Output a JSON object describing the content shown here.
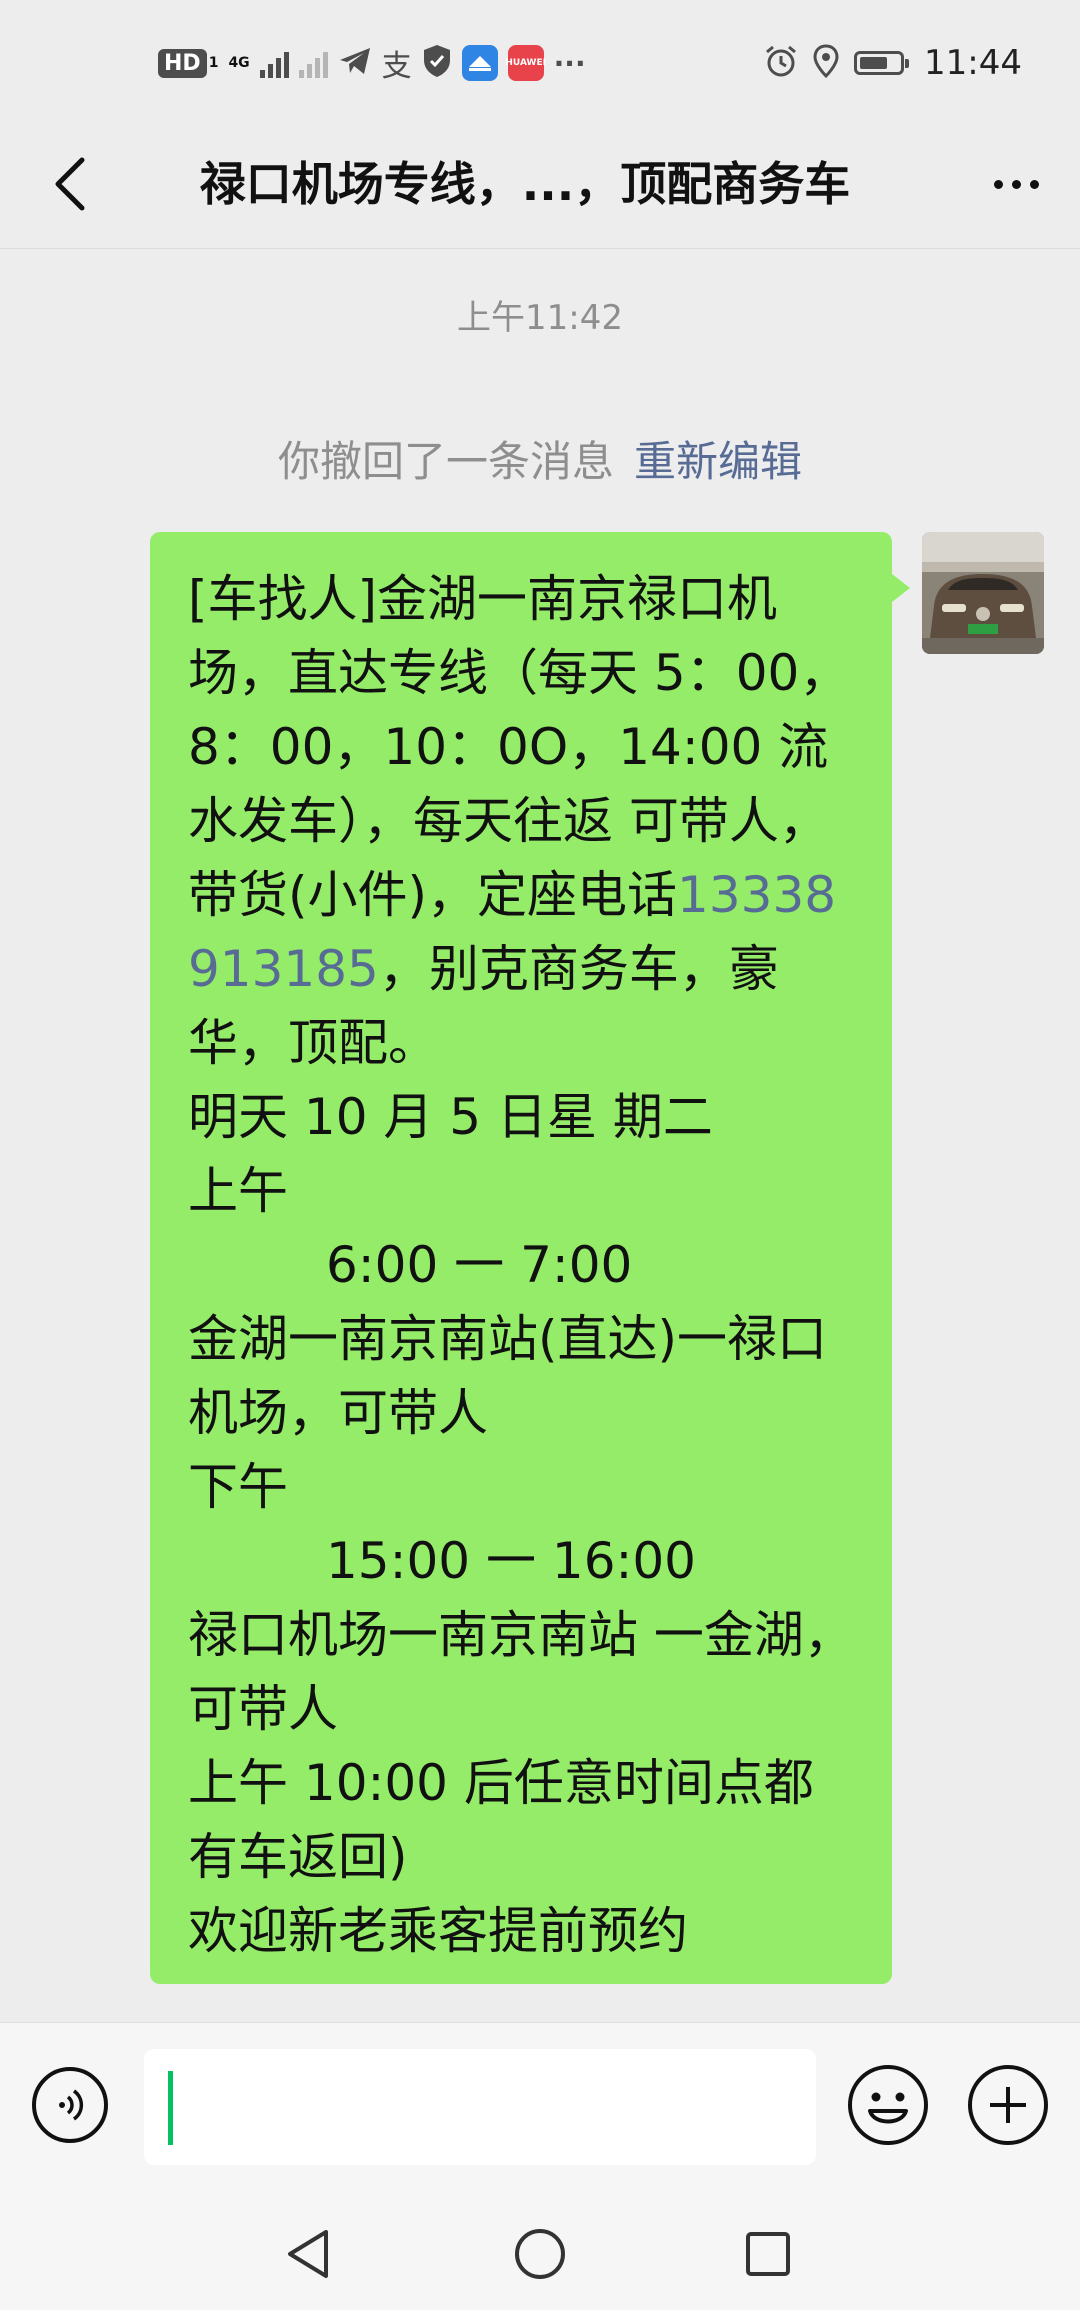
{
  "status_bar": {
    "hd_label": "HD",
    "sim_label": "1",
    "network_label": "4G",
    "time": "11:44",
    "battery_level": 0.7,
    "icons": [
      "hd-icon",
      "signal-icon",
      "signal-no-service-icon",
      "telegram-icon",
      "alipay-icon",
      "vpn-shield-icon",
      "app-icon",
      "huawei-app-icon",
      "more-notifications-icon",
      "alarm-icon",
      "location-icon",
      "battery-icon"
    ],
    "huawei_label": "HUAWEI",
    "more_label": "···"
  },
  "header": {
    "title": "禄口机场专线，...，顶配商务车",
    "back_icon": "back-arrow-icon",
    "more_icon": "more-icon"
  },
  "chat": {
    "timestamp": "上午11:42",
    "recall_text": "你撤回了一条消息",
    "reedit_label": "重新编辑",
    "message": {
      "part1": "[车找人]金湖一南京禄口机场，直达专线（每天 5：00，8：00，10：0O，14:00 流水发车），每天往返 可带人，带货(小件)，定座电话",
      "phone": "13338913185",
      "part2": "，别克商务车，豪华，顶配。\n明天 10 月 5 日星 期二\n上午",
      "time1": "6:00 一 7:00",
      "part3": "金湖一南京南站(直达)一禄口机场，可带人\n下午",
      "time2": "15:00 一 16:00",
      "part4": "禄口机场一南京南站 一金湖，可带人\n上午 10:00 后任意时间点都有车返回)\n欢迎新老乘客提前预约"
    },
    "bubble_color": "#95ec69",
    "link_color": "#576b95"
  },
  "input_bar": {
    "text_value": "",
    "voice_icon": "voice-icon",
    "emoji_icon": "emoji-icon",
    "plus_icon": "plus-icon"
  },
  "nav_bar": {
    "icons": [
      "nav-back-icon",
      "nav-home-icon",
      "nav-recents-icon"
    ]
  }
}
